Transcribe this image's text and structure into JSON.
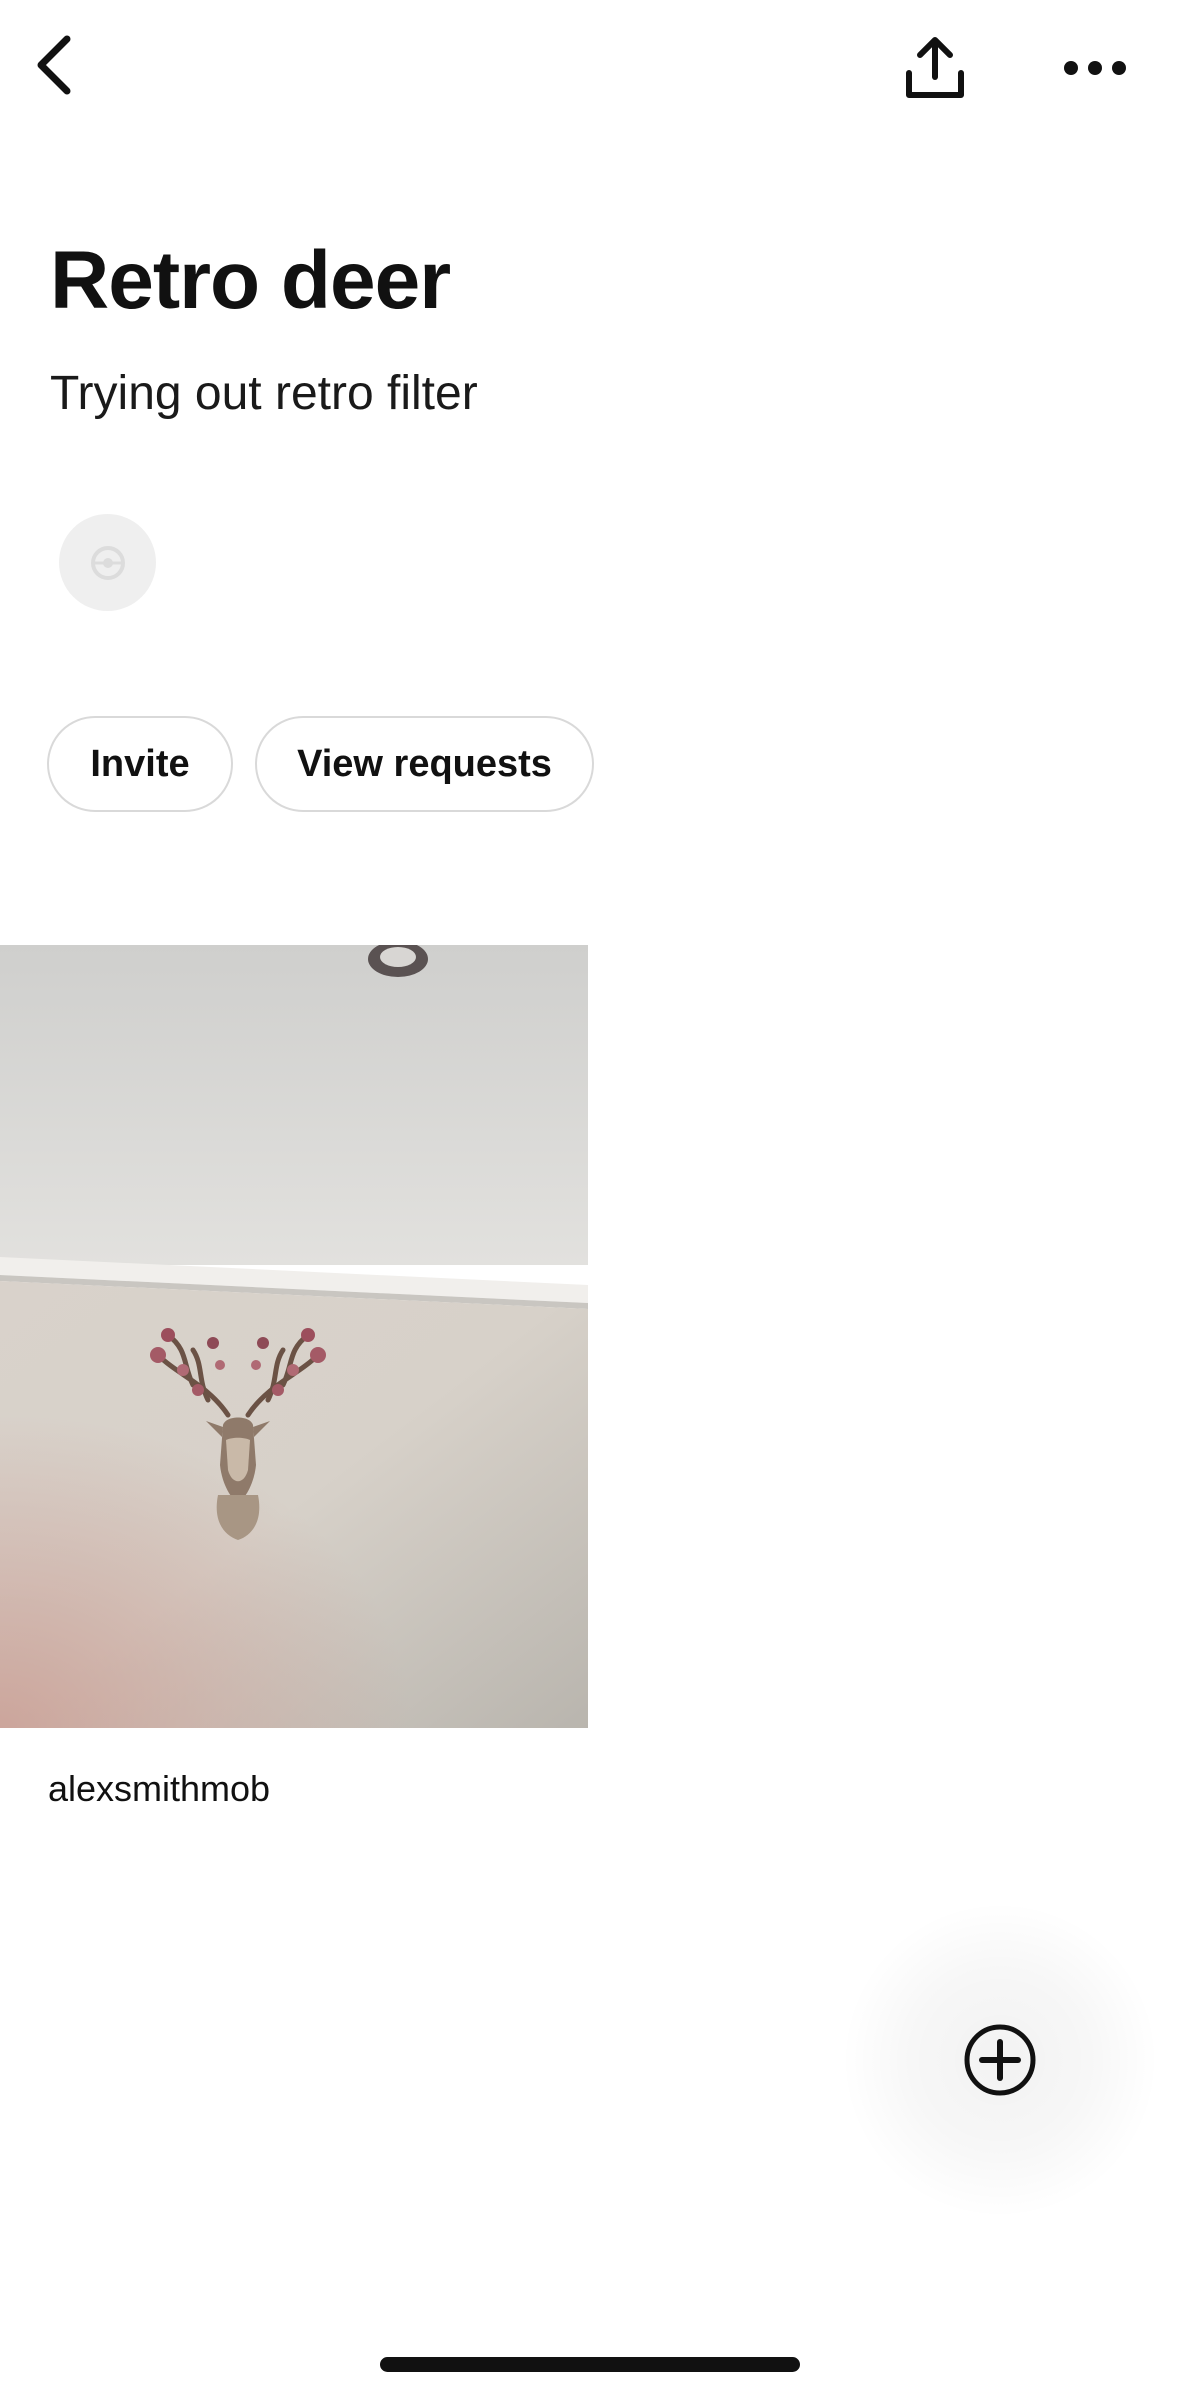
{
  "topbar": {
    "back_icon": "chevron-left-icon",
    "share_icon": "share-upload-icon",
    "more_icon": "more-horizontal-icon"
  },
  "board": {
    "title": "Retro deer",
    "description": "Trying out retro filter"
  },
  "collaborators": {
    "avatar_icon": "collaborator-placeholder-icon"
  },
  "actions": {
    "invite_label": "Invite",
    "view_requests_label": "View requests"
  },
  "pins": [
    {
      "image_description_icon": "deer-head-wall-decal",
      "author": "alexsmithmob"
    }
  ],
  "fab": {
    "icon": "plus-circle-icon"
  },
  "colors": {
    "text_primary": "#111111",
    "pill_border": "#d9d9d9",
    "avatar_bg": "#efefef"
  }
}
